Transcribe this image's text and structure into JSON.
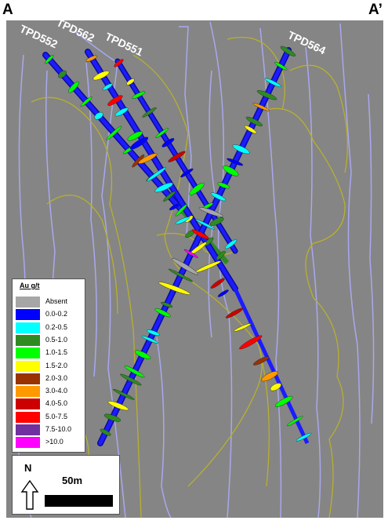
{
  "section_labels": {
    "left": "A",
    "right": "A’"
  },
  "holes": [
    {
      "name": "TPD552"
    },
    {
      "name": "TPD562"
    },
    {
      "name": "TPD551"
    },
    {
      "name": "TPD564"
    }
  ],
  "legend": {
    "title": "Au g/t",
    "items": [
      {
        "label": "Absent",
        "color": "#a6a6a6"
      },
      {
        "label": "0.0-0.2",
        "color": "#0000ff"
      },
      {
        "label": "0.2-0.5",
        "color": "#00ffff"
      },
      {
        "label": "0.5-1.0",
        "color": "#2e8b22"
      },
      {
        "label": "1.0-1.5",
        "color": "#00ff00"
      },
      {
        "label": "1.5-2.0",
        "color": "#ffff00"
      },
      {
        "label": "2.0-3.0",
        "color": "#993300"
      },
      {
        "label": "3.0-4.0",
        "color": "#ff9900"
      },
      {
        "label": "4.0-5.0",
        "color": "#cc0000"
      },
      {
        "label": "5.0-7.5",
        "color": "#ff0000"
      },
      {
        "label": "7.5-10.0",
        "color": "#7030a0"
      },
      {
        "label": ">10.0",
        "color": "#ff00ff"
      }
    ]
  },
  "scale": {
    "north": "N",
    "distance": "50m"
  },
  "colors": {
    "background": "#858585",
    "contour_blue": "#a8a8f0",
    "contour_yellow": "#b8b02c"
  }
}
